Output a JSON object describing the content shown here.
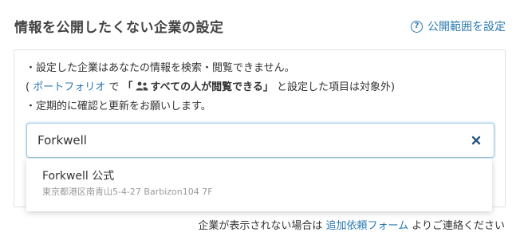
{
  "header": {
    "title": "情報を公開したくない企業の設定",
    "visibility_link": "公開範囲を設定",
    "help_icon": "question-circle"
  },
  "notes": {
    "line1": "・設定した企業はあなたの情報を検索・閲覧できません。",
    "line2_open": "(",
    "line2_portfolio_link": "ポートフォリオ",
    "line2_de": "で",
    "line2_quote_open": "「",
    "line2_setting_label": "すべての人が閲覧できる",
    "line2_quote_close": "」",
    "line2_suffix": "と設定した項目は対象外)",
    "line3": "・定期的に確認と更新をお願いします。",
    "people_icon": "people-icon"
  },
  "search": {
    "value": "Forkwell",
    "clear_icon": "close-icon"
  },
  "suggestions": [
    {
      "name": "Forkwell 公式",
      "address": "東京都港区南青山5-4-27 Barbizon104 7F"
    }
  ],
  "footer": {
    "prefix": "企業が表示されない場合は",
    "link": "追加依頼フォーム",
    "suffix": "よりご連絡ください"
  },
  "colors": {
    "link": "#2a7ab0",
    "input_border": "#9fc7e0",
    "muted": "#999999"
  }
}
